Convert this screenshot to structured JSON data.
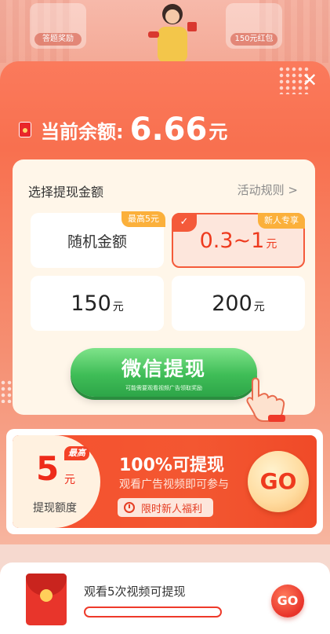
{
  "background": {
    "left_badge_label": "答题奖励",
    "right_badge_label": "150元红包"
  },
  "balance": {
    "label": "当前余额:",
    "value": "6.66",
    "unit": "元"
  },
  "withdraw_card": {
    "title": "选择提现金额",
    "rules_link": "活动规则 >",
    "options": [
      {
        "label": "随机金额",
        "tag": "最高5元",
        "selected": false
      },
      {
        "value": "0.3~1",
        "unit": "元",
        "tag": "新人专享",
        "selected": true
      },
      {
        "value": "150",
        "unit": "元",
        "selected": false
      },
      {
        "value": "200",
        "unit": "元",
        "selected": false
      }
    ],
    "wechat_button": {
      "label": "微信提现",
      "sub_label": "可能需要观看视频广告领取奖励"
    }
  },
  "promo": {
    "amount": "5",
    "unit": "元",
    "max_tag": "最高",
    "limit_label": "提现额度",
    "title": "100%可提现",
    "subtitle": "观看广告视频即可参与",
    "pill_label": "限时新人福利",
    "go_label": "GO"
  },
  "task": {
    "text": "观看5次视频可提现",
    "progress": 0,
    "go_label": "GO"
  },
  "colors": {
    "accent": "#f45a3a",
    "wechat_green": "#3fbd57",
    "tag_orange": "#fbb03b"
  }
}
